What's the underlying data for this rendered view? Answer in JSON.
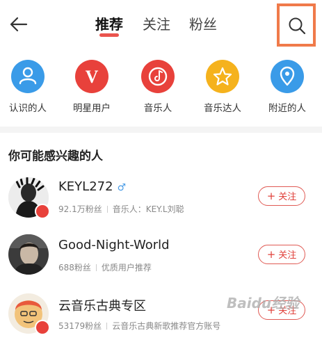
{
  "header": {
    "tabs": [
      {
        "label": "推荐",
        "active": true
      },
      {
        "label": "关注",
        "active": false
      },
      {
        "label": "粉丝",
        "active": false
      }
    ]
  },
  "categories": [
    {
      "label": "认识的人",
      "color": "#3a9be8",
      "icon": "person-icon"
    },
    {
      "label": "明星用户",
      "color": "#e8413b",
      "icon": "v-icon"
    },
    {
      "label": "音乐人",
      "color": "#e8413b",
      "icon": "music-disc-icon"
    },
    {
      "label": "音乐达人",
      "color": "#f5b21d",
      "icon": "star-icon"
    },
    {
      "label": "附近的人",
      "color": "#3a9be8",
      "icon": "location-icon"
    }
  ],
  "section_title": "你可能感兴趣的人",
  "users": [
    {
      "name": "KEYL272",
      "gender": "♂",
      "fans": "92.1万粉丝",
      "desc": "音乐人：KEY.L刘聪",
      "follow_label": "关注"
    },
    {
      "name": "Good-Night-World",
      "fans": "688粉丝",
      "desc": "优质用户推荐",
      "follow_label": "关注"
    },
    {
      "name": "云音乐古典专区",
      "fans": "53179粉丝",
      "desc": "云音乐古典新歌推荐官方账号",
      "follow_label": "关注"
    }
  ],
  "watermark": "Baidu经验",
  "colors": {
    "accent": "#e8413b",
    "highlight_box": "#f07a4a"
  }
}
